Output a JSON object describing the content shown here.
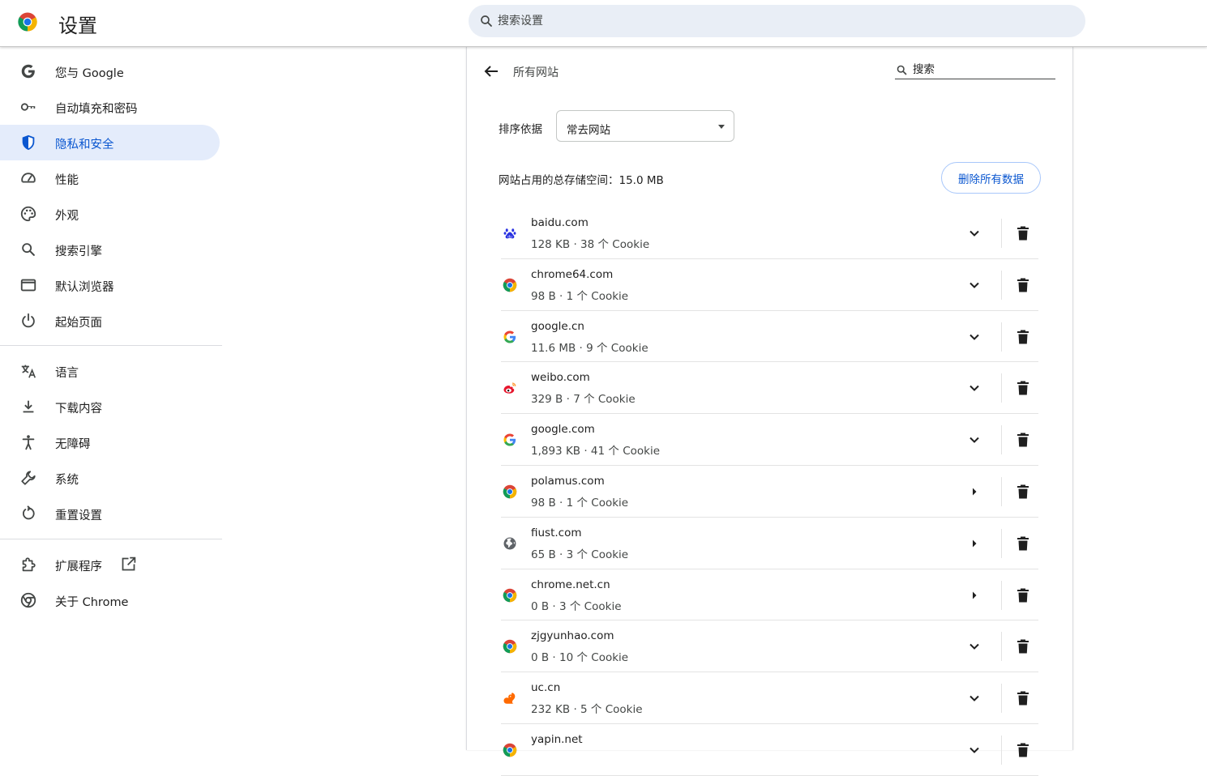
{
  "header": {
    "title": "设置",
    "search_placeholder": "搜索设置"
  },
  "sidebar": {
    "items": [
      {
        "label": "您与 Google",
        "icon": "google-g-icon"
      },
      {
        "label": "自动填充和密码",
        "icon": "key-icon"
      },
      {
        "label": "隐私和安全",
        "icon": "shield-icon",
        "active": true
      },
      {
        "label": "性能",
        "icon": "speedometer-icon"
      },
      {
        "label": "外观",
        "icon": "palette-icon"
      },
      {
        "label": "搜索引擎",
        "icon": "search-icon"
      },
      {
        "label": "默认浏览器",
        "icon": "browser-window-icon"
      },
      {
        "label": "起始页面",
        "icon": "power-icon"
      },
      {
        "label": "语言",
        "icon": "translate-icon"
      },
      {
        "label": "下载内容",
        "icon": "download-icon"
      },
      {
        "label": "无障碍",
        "icon": "accessibility-icon"
      },
      {
        "label": "系统",
        "icon": "wrench-icon"
      },
      {
        "label": "重置设置",
        "icon": "reset-icon"
      },
      {
        "label": "扩展程序",
        "icon": "puzzle-icon"
      },
      {
        "label": "关于 Chrome",
        "icon": "chrome-icon"
      }
    ]
  },
  "main": {
    "page_title": "所有网站",
    "search_placeholder": "搜索",
    "sort_label": "排序依据",
    "sort_value": "常去网站",
    "storage_text": "网站占用的总存储空间：15.0 MB",
    "clear_all_label": "删除所有数据",
    "sites": [
      {
        "name": "baidu.com",
        "meta": "128 KB · 38 个 Cookie",
        "favicon": "baidu-paw-icon",
        "expanded_state": "chevron-down"
      },
      {
        "name": "chrome64.com",
        "meta": "98 B · 1 个 Cookie",
        "favicon": "chrome-icon",
        "expanded_state": "chevron-down"
      },
      {
        "name": "google.cn",
        "meta": "11.6 MB · 9 个 Cookie",
        "favicon": "google-g-icon",
        "expanded_state": "chevron-down"
      },
      {
        "name": "weibo.com",
        "meta": "329 B · 7 个 Cookie",
        "favicon": "weibo-icon",
        "expanded_state": "chevron-down"
      },
      {
        "name": "google.com",
        "meta": "1,893 KB · 41 个 Cookie",
        "favicon": "google-g-icon",
        "expanded_state": "chevron-down"
      },
      {
        "name": "polamus.com",
        "meta": "98 B · 1 个 Cookie",
        "favicon": "chrome-icon",
        "expanded_state": "arrow-right"
      },
      {
        "name": "fiust.com",
        "meta": "65 B · 3 个 Cookie",
        "favicon": "globe-icon",
        "expanded_state": "arrow-right"
      },
      {
        "name": "chrome.net.cn",
        "meta": "0 B · 3 个 Cookie",
        "favicon": "chrome-icon",
        "expanded_state": "arrow-right"
      },
      {
        "name": "zjgyunhao.com",
        "meta": "0 B · 10 个 Cookie",
        "favicon": "chrome-icon",
        "expanded_state": "chevron-down"
      },
      {
        "name": "uc.cn",
        "meta": "232 KB · 5 个 Cookie",
        "favicon": "uc-squirrel-icon",
        "expanded_state": "chevron-down"
      },
      {
        "name": "yapin.net",
        "meta": "",
        "favicon": "chrome-icon",
        "expanded_state": "chevron-down"
      }
    ]
  },
  "colors": {
    "accent": "#0b57d0",
    "active_nav_bg": "#e4ecfb",
    "search_bg": "#e9eef6",
    "divider": "#dadce0"
  }
}
